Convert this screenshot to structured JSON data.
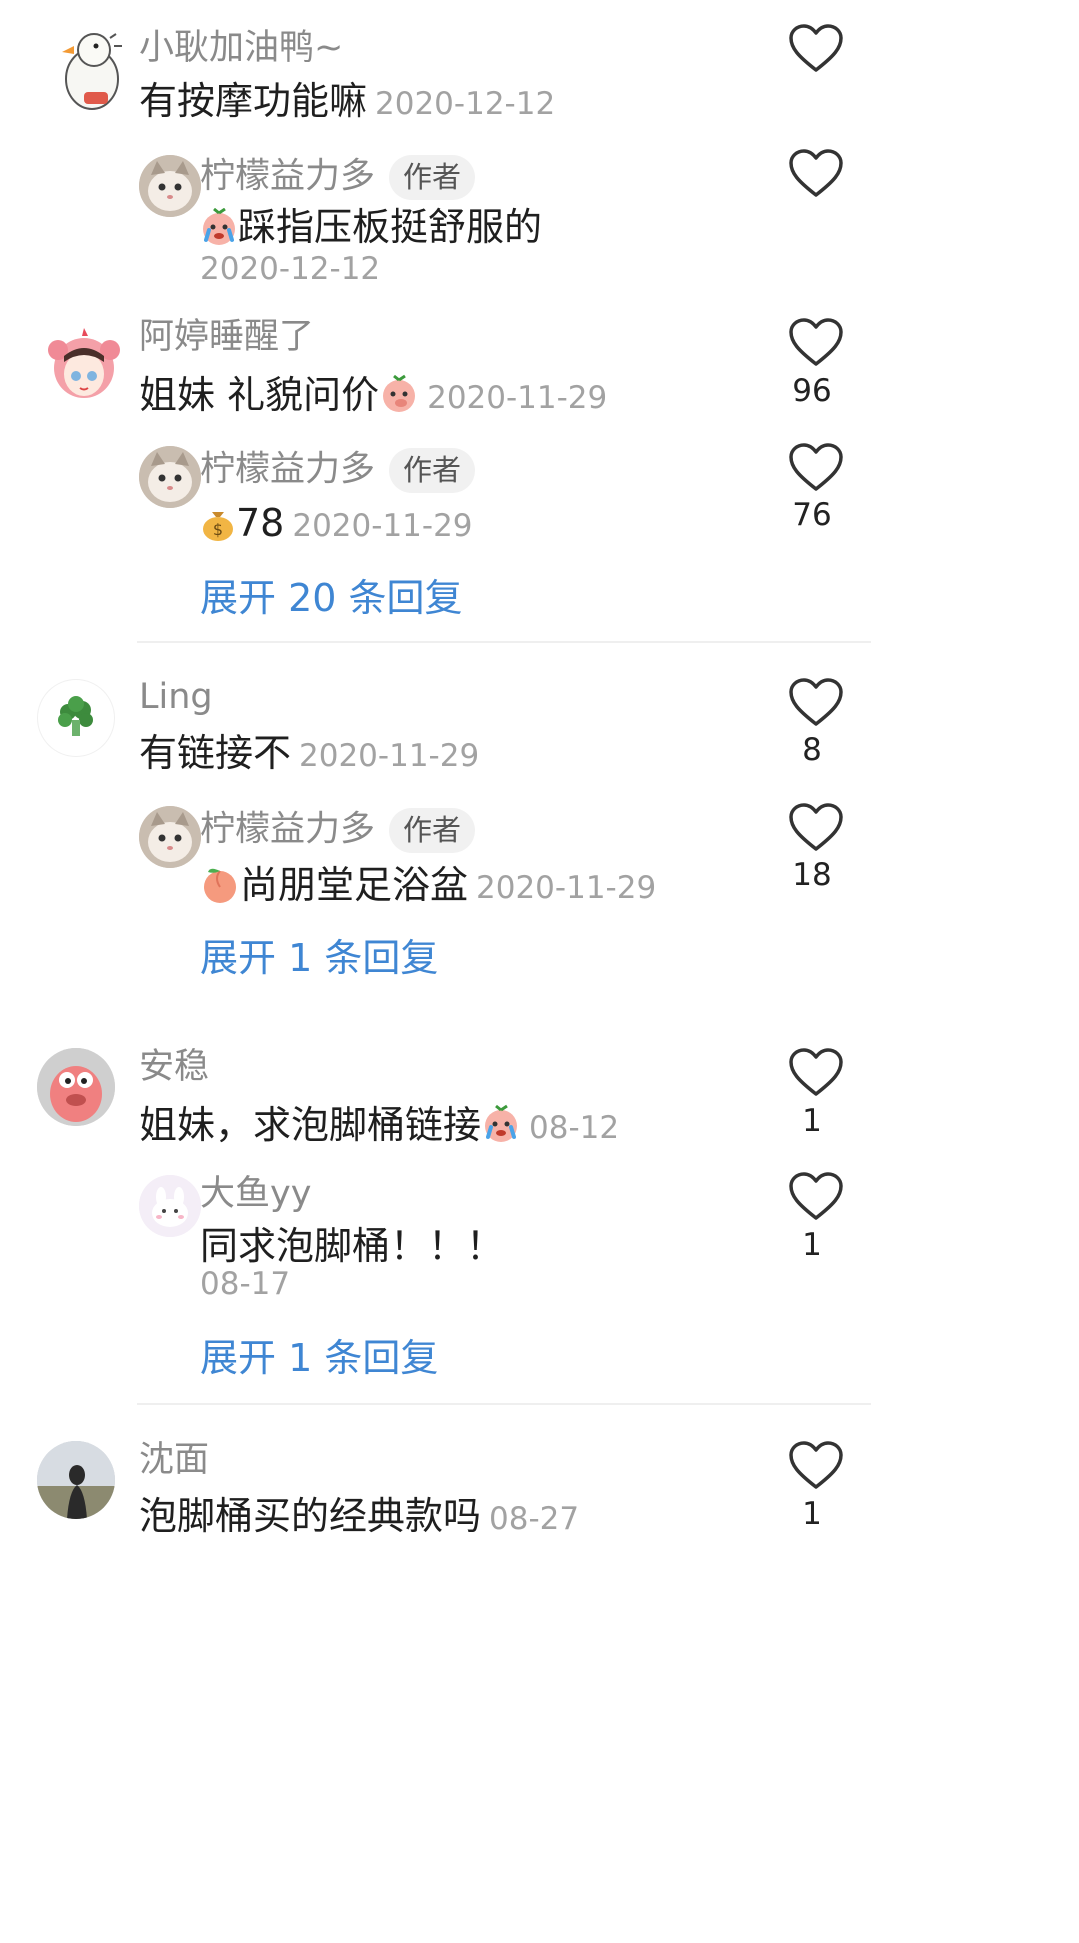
{
  "comments": [
    {
      "user": "小耿加油鸭~",
      "text": "有按摩功能嘛",
      "date": "2020-12-12",
      "likes": "",
      "reply": {
        "user": "柠檬益力多",
        "badge": "作者",
        "text": "踩指压板挺舒服的",
        "emoji": "crying-peach-emoji",
        "date": "2020-12-12",
        "likes": ""
      },
      "expand": ""
    },
    {
      "user": "阿婷睡醒了",
      "text": "姐妹 礼貌问价",
      "text_emoji": "peach-face-emoji",
      "date": "2020-11-29",
      "likes": "96",
      "reply": {
        "user": "柠檬益力多",
        "badge": "作者",
        "text": "78",
        "emoji": "money-bag-emoji",
        "date": "2020-11-29",
        "likes": "76"
      },
      "expand": "展开 20 条回复"
    },
    {
      "user": "Ling",
      "text": "有链接不",
      "date": "2020-11-29",
      "likes": "8",
      "reply": {
        "user": "柠檬益力多",
        "badge": "作者",
        "text": "尚朋堂足浴盆",
        "emoji": "peach-emoji",
        "date": "2020-11-29",
        "likes": "18"
      },
      "expand": "展开 1 条回复"
    },
    {
      "user": "安稳",
      "text": "姐妹，求泡脚桶链接",
      "text_emoji": "crying-peach-emoji",
      "date": "08-12",
      "likes": "1",
      "reply": {
        "user": "大鱼yy",
        "badge": "",
        "text": "同求泡脚桶！！！",
        "date": "08-17",
        "likes": "1"
      },
      "expand": "展开 1 条回复"
    },
    {
      "user": "沈面",
      "text": "泡脚桶买的经典款吗",
      "date": "08-27",
      "likes": "1"
    }
  ],
  "colors": {
    "link": "#3f86d3",
    "name": "#8a8a8a",
    "date": "#a2a2a2"
  }
}
